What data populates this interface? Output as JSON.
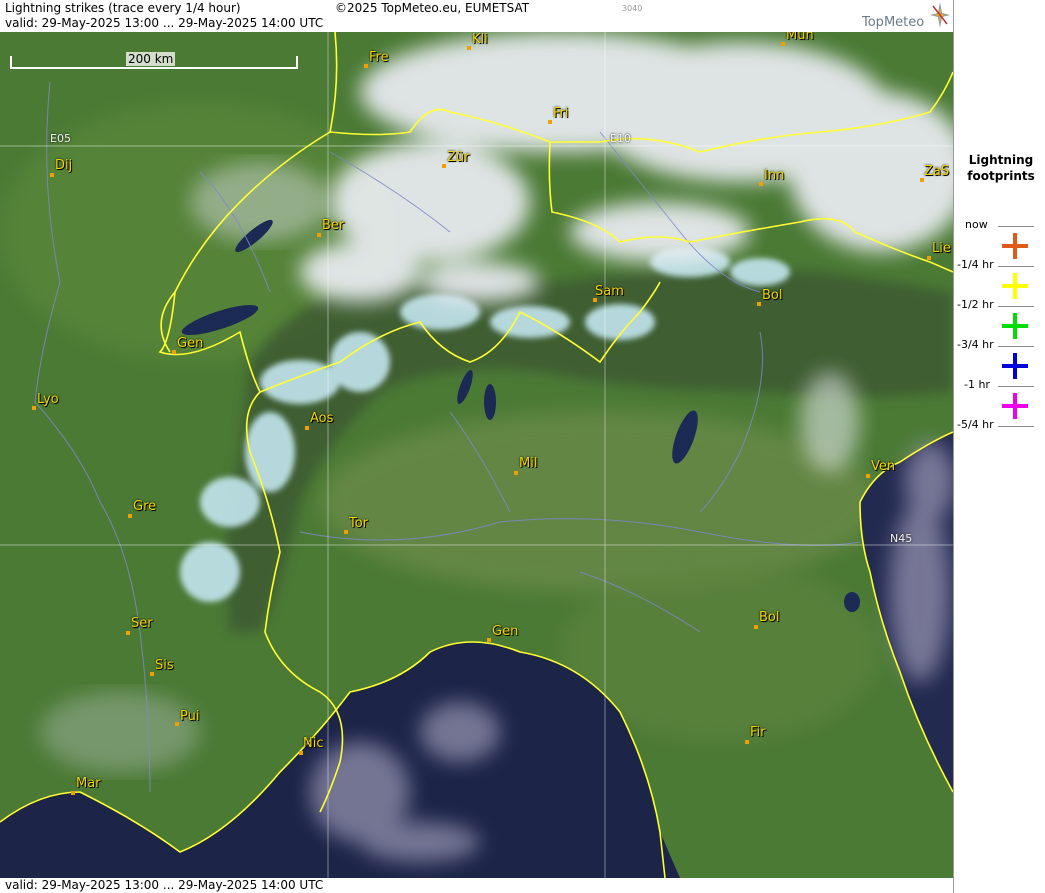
{
  "header": {
    "title": "Lightning strikes (trace every 1/4 hour)",
    "copyright": "©2025 TopMeteo.eu, EUMETSAT",
    "code": "3040",
    "valid": "valid:  29-May-2025 13:00 ... 29-May-2025 14:00 UTC",
    "logo": "TopMeteo"
  },
  "footer": {
    "valid": "valid:  29-May-2025 13:00 ... 29-May-2025 14:00 UTC"
  },
  "scale": {
    "label": "200 km"
  },
  "grid": {
    "e05": "E05",
    "e10": "E10",
    "n45": "N45"
  },
  "cities": [
    {
      "name": "Kli"
    },
    {
      "name": "Mun"
    },
    {
      "name": "Fre"
    },
    {
      "name": "Fri"
    },
    {
      "name": "Dij"
    },
    {
      "name": "Zür"
    },
    {
      "name": "Inn"
    },
    {
      "name": "ZaS"
    },
    {
      "name": "Ber"
    },
    {
      "name": "Lie"
    },
    {
      "name": "Sam"
    },
    {
      "name": "Bol"
    },
    {
      "name": "Gen"
    },
    {
      "name": "Lyo"
    },
    {
      "name": "Aos"
    },
    {
      "name": "Mil"
    },
    {
      "name": "Ven"
    },
    {
      "name": "Gre"
    },
    {
      "name": "Tor"
    },
    {
      "name": "Ser"
    },
    {
      "name": "Gen"
    },
    {
      "name": "Bol"
    },
    {
      "name": "Sis"
    },
    {
      "name": "Pui"
    },
    {
      "name": "Nic"
    },
    {
      "name": "Fir"
    },
    {
      "name": "Mar"
    }
  ],
  "legend": {
    "title_line1": "Lightning",
    "title_line2": "footprints",
    "rows": [
      {
        "label": "now",
        "color": ""
      },
      {
        "label": "-1/4 hr",
        "color": "#e05a1a"
      },
      {
        "label": "-1/2 hr",
        "color": "#ffff00"
      },
      {
        "label": "-3/4 hr",
        "color": "#00dd00"
      },
      {
        "label": "-1 hr",
        "color": "#0000dd"
      },
      {
        "label": "-5/4 hr",
        "color": "#ee00ee"
      }
    ]
  },
  "colors": {
    "land": "#4a7a34",
    "sea": "#1c2448",
    "border": "#ffff33",
    "cloud": "#e8eaf0",
    "snow": "#bfe8f2"
  }
}
